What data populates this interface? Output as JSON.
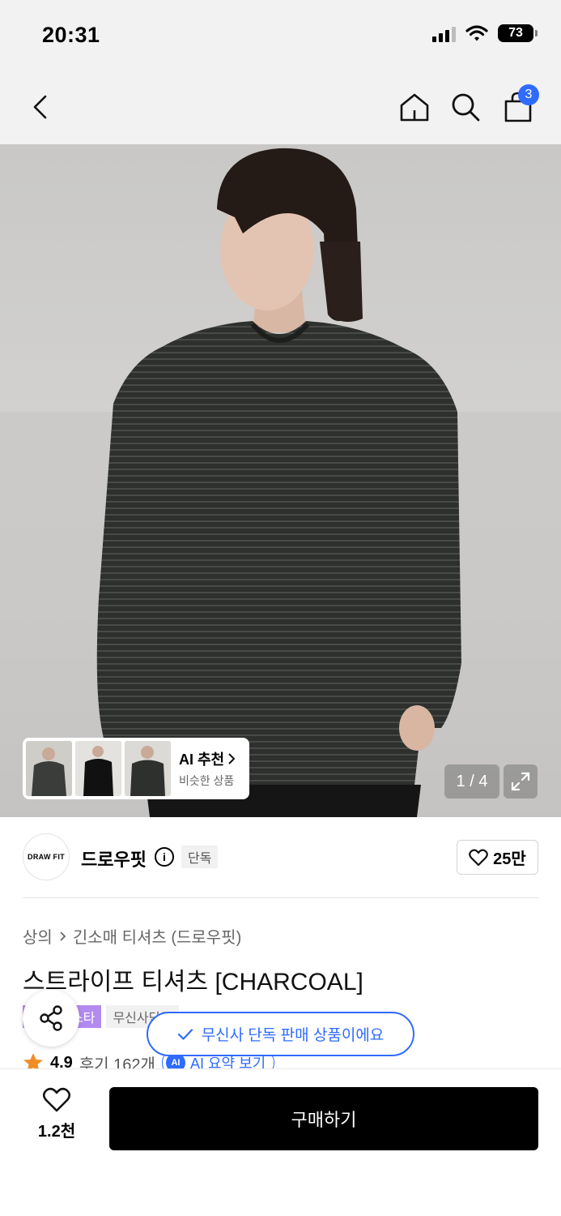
{
  "status_bar": {
    "time": "20:31",
    "battery": "73"
  },
  "nav": {
    "back_icon": "chevron-left-icon",
    "home_icon": "home-icon",
    "search_icon": "search-icon",
    "cart_icon": "shopping-bag-icon",
    "cart_count": "3"
  },
  "gallery": {
    "counter": "1 / 4",
    "ai_recommend": {
      "title": "AI 추천",
      "subtitle": "비슷한 상품"
    }
  },
  "brand": {
    "logo_text": "DRAW FIT",
    "name": "드로우핏",
    "exclusive_tag": "단독",
    "likes": "25만"
  },
  "product": {
    "breadcrumb": [
      "상의",
      "긴소매 티셔츠 (드로우핏)"
    ],
    "title": "스트라이프 티셔츠 [CHARCOAL]",
    "tags": [
      "스타",
      "무신사단독"
    ],
    "rating": "4.9",
    "review_count": "후기 162개",
    "ai_summary_badge": "AI",
    "ai_summary_label": "AI 요약 보기"
  },
  "toast": {
    "message": "무신사 단독 판매 상품이에요"
  },
  "bottom_bar": {
    "wish_count": "1.2천",
    "buy_label": "구매하기"
  },
  "colors": {
    "accent_blue": "#2f6bff",
    "tag_purple": "#b38af0",
    "buy_button": "#000000"
  }
}
